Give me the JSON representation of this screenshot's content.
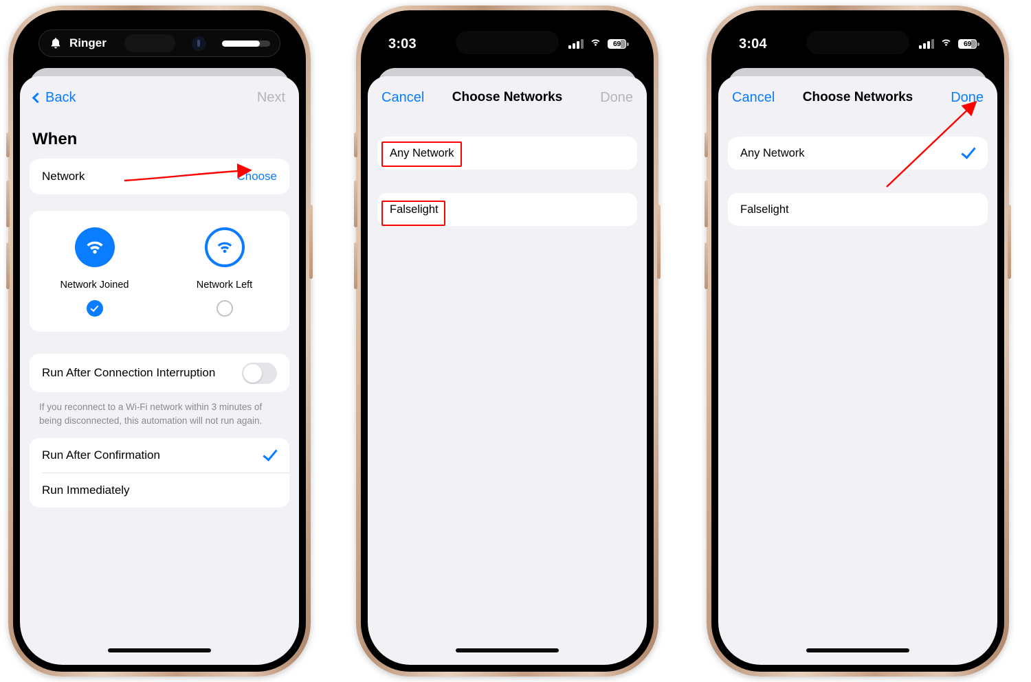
{
  "phones": [
    {
      "id": "phone-automation-when",
      "status": {
        "style": "dynamic-island",
        "island_label": "Ringer",
        "island_icon": "bell-icon",
        "volume_percent": 78
      },
      "nav": {
        "back_label": "Back",
        "title": "",
        "right_label": "Next",
        "right_enabled": false
      },
      "section_title": "When",
      "network_row": {
        "label": "Network",
        "action": "Choose"
      },
      "trigger_options": [
        {
          "icon": "wifi-icon",
          "style": "filled",
          "caption": "Network Joined",
          "selected": true
        },
        {
          "icon": "wifi-icon",
          "style": "outline",
          "caption": "Network Left",
          "selected": false
        }
      ],
      "interruption": {
        "label": "Run After Connection Interruption",
        "enabled": false
      },
      "footnote": "If you reconnect to a Wi‑Fi network within 3 minutes of being disconnected, this automation will not run again.",
      "run_modes": [
        {
          "label": "Run After Confirmation",
          "selected": true
        },
        {
          "label": "Run Immediately",
          "selected": false
        }
      ]
    },
    {
      "id": "phone-choose-networks-empty",
      "status": {
        "style": "plain",
        "time": "3:03",
        "signal_icon": "cellular-bars-icon",
        "wifi_icon": "wifi-icon",
        "battery_icon": "battery-icon",
        "battery_level": "69"
      },
      "nav": {
        "left_label": "Cancel",
        "title": "Choose Networks",
        "right_label": "Done",
        "right_enabled": false
      },
      "networks": [
        {
          "label": "Any Network",
          "selected": false,
          "highlighted": true
        },
        {
          "label": "Falselight",
          "selected": false,
          "highlighted": true
        }
      ]
    },
    {
      "id": "phone-choose-networks-selected",
      "status": {
        "style": "plain",
        "time": "3:04",
        "signal_icon": "cellular-bars-icon",
        "wifi_icon": "wifi-icon",
        "battery_icon": "battery-icon",
        "battery_level": "69"
      },
      "nav": {
        "left_label": "Cancel",
        "title": "Choose Networks",
        "right_label": "Done",
        "right_enabled": true
      },
      "networks": [
        {
          "label": "Any Network",
          "selected": true,
          "highlighted": false
        },
        {
          "label": "Falselight",
          "selected": false,
          "highlighted": false
        }
      ]
    }
  ],
  "annotations": {
    "color": "#ff0000",
    "arrow_to_choose": "horizontal arrow pointing right at the Choose button",
    "box_any_network": "red box around Any Network label",
    "box_falselight": "red box around Falselight label",
    "arrow_to_done": "diagonal arrow pointing up-right at the Done button"
  },
  "colors": {
    "accent_blue": "#0a7cff",
    "annotation_red": "#ff0000",
    "sheet_bg": "#f1f1f6",
    "card_bg": "#ffffff",
    "muted_text": "#8a8a8e",
    "disabled_text": "#b4b4b9"
  }
}
